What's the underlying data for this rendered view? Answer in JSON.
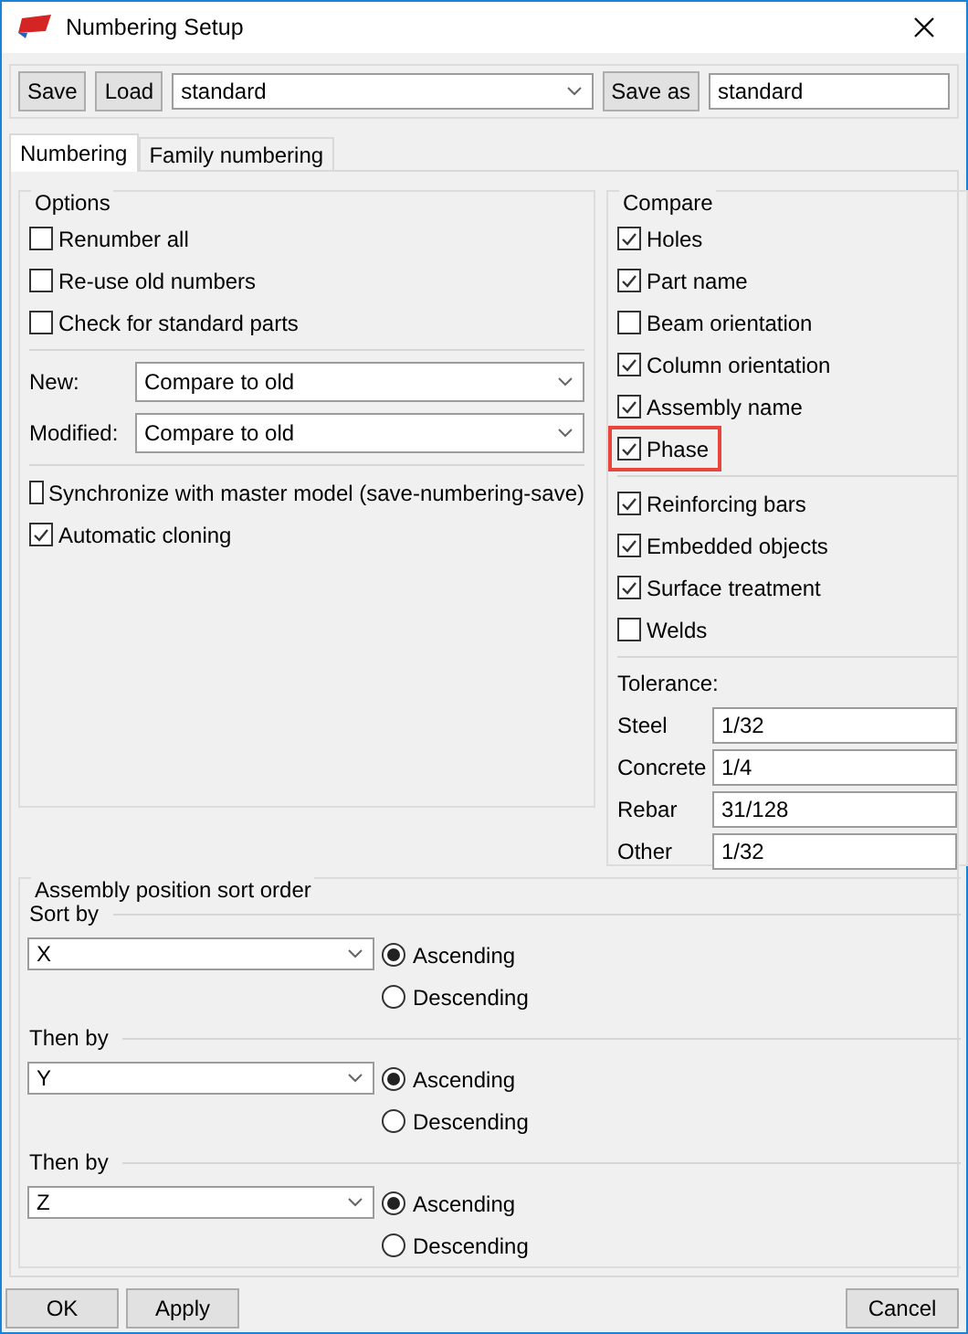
{
  "window": {
    "title": "Numbering Setup"
  },
  "toolbar": {
    "save_button": "Save",
    "load_button": "Load",
    "preset": "standard",
    "save_as_button": "Save as",
    "save_as_name": "standard"
  },
  "tabs": [
    {
      "label": "Numbering",
      "selected": true
    },
    {
      "label": "Family numbering",
      "selected": false
    }
  ],
  "options": {
    "title": "Options",
    "sections": [
      {
        "kind": "checks",
        "items": [
          {
            "label": "Renumber all",
            "checked": false
          },
          {
            "label": "Re-use old numbers",
            "checked": false
          },
          {
            "label": "Check for standard parts",
            "checked": false
          }
        ]
      },
      {
        "kind": "selects",
        "items": [
          {
            "label": "New:",
            "value": "Compare to old"
          },
          {
            "label": "Modified:",
            "value": "Compare to old"
          }
        ]
      },
      {
        "kind": "checks",
        "items": [
          {
            "label": "Synchronize with master model (save-numbering-save)",
            "checked": false
          },
          {
            "label": "Automatic cloning",
            "checked": true
          }
        ]
      }
    ]
  },
  "compare": {
    "title": "Compare",
    "groups": [
      {
        "items": [
          {
            "label": "Holes",
            "checked": true,
            "highlighted": false
          },
          {
            "label": "Part name",
            "checked": true,
            "highlighted": false
          },
          {
            "label": "Beam orientation",
            "checked": false,
            "highlighted": false
          },
          {
            "label": "Column orientation",
            "checked": true,
            "highlighted": false
          },
          {
            "label": "Assembly name",
            "checked": true,
            "highlighted": false
          },
          {
            "label": "Phase",
            "checked": true,
            "highlighted": true
          }
        ]
      },
      {
        "items": [
          {
            "label": "Reinforcing bars",
            "checked": true,
            "highlighted": false
          },
          {
            "label": "Embedded objects",
            "checked": true,
            "highlighted": false
          },
          {
            "label": "Surface treatment",
            "checked": true,
            "highlighted": false
          },
          {
            "label": "Welds",
            "checked": false,
            "highlighted": false
          }
        ]
      }
    ],
    "tolerance": {
      "title": "Tolerance:",
      "rows": [
        {
          "label": "Steel",
          "value": "1/32"
        },
        {
          "label": "Concrete",
          "value": "1/4"
        },
        {
          "label": "Rebar",
          "value": "31/128"
        },
        {
          "label": "Other",
          "value": "1/32"
        }
      ]
    }
  },
  "sort_order": {
    "title": "Assembly position sort order",
    "levels": [
      {
        "label": "Sort by",
        "value": "X",
        "options": [
          {
            "label": "Ascending",
            "selected": true
          },
          {
            "label": "Descending",
            "selected": false
          }
        ]
      },
      {
        "label": "Then by",
        "value": "Y",
        "options": [
          {
            "label": "Ascending",
            "selected": true
          },
          {
            "label": "Descending",
            "selected": false
          }
        ]
      },
      {
        "label": "Then by",
        "value": "Z",
        "options": [
          {
            "label": "Ascending",
            "selected": true
          },
          {
            "label": "Descending",
            "selected": false
          }
        ]
      }
    ]
  },
  "buttons": {
    "left": [
      "OK",
      "Apply"
    ],
    "right": [
      "Cancel"
    ]
  }
}
